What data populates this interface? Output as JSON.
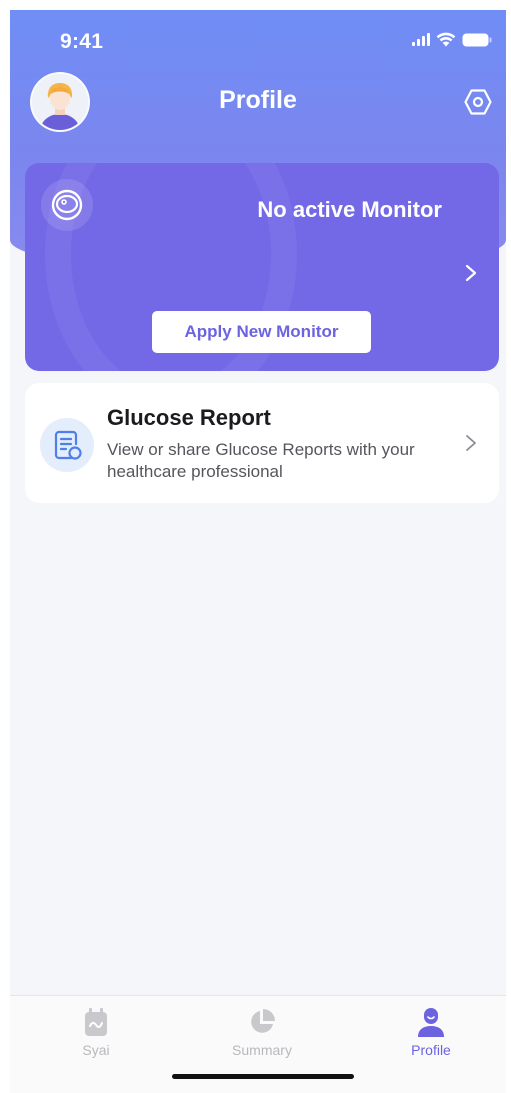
{
  "status_bar": {
    "time": "9:41"
  },
  "header": {
    "title": "Profile",
    "avatar_icon": "avatar",
    "settings_icon": "settings-hexagon-icon"
  },
  "monitor_card": {
    "title": "No active Monitor",
    "button_label": "Apply New Monitor",
    "icon": "sensor-icon"
  },
  "report_card": {
    "title": "Glucose Report",
    "description": "View or share Glucose Reports with your healthcare professional",
    "icon": "report-document-icon"
  },
  "tabbar": {
    "tabs": [
      {
        "label": "Syai",
        "icon": "sensor-tab-icon",
        "active": false
      },
      {
        "label": "Summary",
        "icon": "pie-chart-icon",
        "active": false
      },
      {
        "label": "Profile",
        "icon": "person-icon",
        "active": true
      }
    ]
  },
  "colors": {
    "accent": "#6c63e0",
    "header_gradient_top": "#6f8ef6",
    "card_purple": "#7369e6",
    "tab_inactive": "#b8b8bd"
  }
}
